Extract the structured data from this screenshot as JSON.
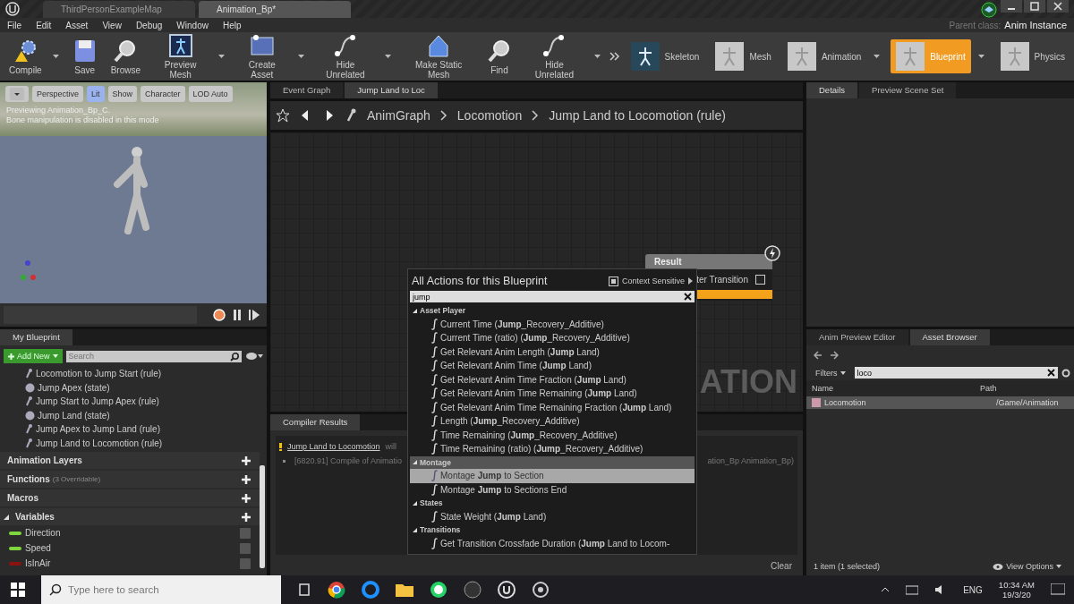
{
  "title_tabs": [
    {
      "label": "ThirdPersonExampleMap",
      "selected": false
    },
    {
      "label": "Animation_Bp*",
      "selected": true
    }
  ],
  "parent_class": {
    "label": "Parent class:",
    "value": "Anim Instance"
  },
  "menu": [
    "File",
    "Edit",
    "Asset",
    "View",
    "Debug",
    "Window",
    "Help"
  ],
  "toolbar": [
    {
      "label": "Compile",
      "kind": "compile",
      "dropdown": true
    },
    {
      "label": "Save",
      "kind": "save",
      "dropdown": false
    },
    {
      "label": "Browse",
      "kind": "browse",
      "dropdown": false
    },
    {
      "label": "Preview Mesh",
      "kind": "mesh",
      "dropdown": true
    },
    {
      "label": "Create Asset",
      "kind": "asset",
      "dropdown": true
    },
    {
      "label": "Hide Unrelated",
      "kind": "unrelated",
      "dropdown": true
    },
    {
      "label": "Make Static Mesh",
      "kind": "static",
      "dropdown": false
    },
    {
      "label": "Find",
      "kind": "find",
      "dropdown": false
    },
    {
      "label": "Hide Unrelated",
      "kind": "unrelated",
      "dropdown": true
    }
  ],
  "modes": [
    {
      "label": "Skeleton",
      "selected": false,
      "dropdown": false
    },
    {
      "label": "Mesh",
      "selected": false,
      "dropdown": false
    },
    {
      "label": "Animation",
      "selected": false,
      "dropdown": true
    },
    {
      "label": "Blueprint",
      "selected": true,
      "dropdown": true
    },
    {
      "label": "Physics",
      "selected": false,
      "dropdown": false
    }
  ],
  "viewport": {
    "buttons": [
      {
        "label": "Perspective",
        "selected": false
      },
      {
        "label": "Lit",
        "selected": true
      },
      {
        "label": "Show",
        "selected": false
      },
      {
        "label": "Character",
        "selected": false
      },
      {
        "label": "LOD Auto",
        "selected": false
      }
    ],
    "messages": [
      "Previewing Animation_Bp_C.",
      "Bone manipulation is disabled in this mode"
    ]
  },
  "my_blueprint": {
    "title": "My Blueprint",
    "add_button": "Add New",
    "search_placeholder": "Search",
    "tree": [
      {
        "label": "Locomotion to Jump Start (rule)",
        "kind": "rule"
      },
      {
        "label": "Jump Apex (state)",
        "kind": "state"
      },
      {
        "label": "Jump Start to Jump Apex (rule)",
        "kind": "rule"
      },
      {
        "label": "Jump Land (state)",
        "kind": "state"
      },
      {
        "label": "Jump Apex to Jump Land (rule)",
        "kind": "rule"
      },
      {
        "label": "Jump Land to Locomotion (rule)",
        "kind": "rule"
      }
    ],
    "sections": [
      {
        "label": "Animation Layers",
        "expanded": false
      },
      {
        "label": "Functions",
        "note": "(3 Overridable)",
        "expanded": false
      },
      {
        "label": "Macros",
        "expanded": false
      },
      {
        "label": "Variables",
        "expanded": true
      }
    ],
    "variables": [
      {
        "name": "Direction",
        "color": "#7ed63c"
      },
      {
        "name": "Speed",
        "color": "#7ed63c"
      },
      {
        "name": "IsInAir",
        "color": "#8c1212"
      }
    ]
  },
  "graph": {
    "tabs": [
      {
        "label": "Event Graph",
        "selected": false
      },
      {
        "label": "Jump Land to Loc",
        "selected": true
      }
    ],
    "breadcrumb": [
      "AnimGraph",
      "Locomotion",
      "Jump Land to Locomotion (rule)"
    ],
    "result_node": {
      "title": "Result",
      "pin": "ter Transition",
      "checked": false
    },
    "background_label": "ATION"
  },
  "action_menu": {
    "title": "All Actions for this Blueprint",
    "context_sensitive": {
      "label": "Context Sensitive",
      "checked": true
    },
    "search": "jump",
    "groups": [
      {
        "label": "Asset Player",
        "items": [
          {
            "text": "Current Time (**Jump**_Recovery_Additive)",
            "selected": false
          },
          {
            "text": "Current Time (ratio) (**Jump**_Recovery_Additive)",
            "selected": false
          },
          {
            "text": "Get Relevant Anim Length (**Jump** Land)",
            "selected": false
          },
          {
            "text": "Get Relevant Anim Time (**Jump** Land)",
            "selected": false
          },
          {
            "text": "Get Relevant Anim Time Fraction (**Jump** Land)",
            "selected": false
          },
          {
            "text": "Get Relevant Anim Time Remaining (**Jump** Land)",
            "selected": false
          },
          {
            "text": "Get Relevant Anim Time Remaining Fraction (**Jump** Land)",
            "selected": false
          },
          {
            "text": "Length (**Jump**_Recovery_Additive)",
            "selected": false
          },
          {
            "text": "Time Remaining (**Jump**_Recovery_Additive)",
            "selected": false
          },
          {
            "text": "Time Remaining (ratio) (**Jump**_Recovery_Additive)",
            "selected": false
          }
        ]
      },
      {
        "label": "Montage",
        "items": [
          {
            "text": "Montage **Jump** to Section",
            "selected": true
          },
          {
            "text": "Montage **Jump** to Sections End",
            "selected": false
          }
        ]
      },
      {
        "label": "States",
        "items": [
          {
            "text": "State Weight (**Jump** Land)",
            "selected": false
          }
        ]
      },
      {
        "label": "Transitions",
        "items": [
          {
            "text": "Get Transition Crossfade Duration (**Jump** Land to Locom-",
            "selected": false
          }
        ]
      }
    ]
  },
  "compiler": {
    "title": "Compiler Results",
    "lines": [
      {
        "kind": "warning",
        "link": "Jump Land to Locomotion",
        "text": "will"
      },
      {
        "kind": "info",
        "text": "[6820.91] Compile of Animatio",
        "tail": "ation_Bp Animation_Bp)"
      }
    ],
    "clear": "Clear"
  },
  "details": {
    "tabs": [
      {
        "label": "Details",
        "selected": true
      },
      {
        "label": "Preview Scene Set",
        "selected": false
      }
    ]
  },
  "asset_browser": {
    "tabs": [
      {
        "label": "Anim Preview Editor",
        "selected": false
      },
      {
        "label": "Asset Browser",
        "selected": true
      }
    ],
    "filters": "Filters",
    "search": "loco",
    "columns": [
      "Name",
      "Path"
    ],
    "rows": [
      {
        "name": "Locomotion",
        "path": "/Game/Animation",
        "selected": true
      }
    ],
    "status": "1 item (1 selected)",
    "view_options": "View Options"
  },
  "taskbar": {
    "search_placeholder": "Type here to search",
    "language": "ENG",
    "time": "10:34 AM",
    "date": "19/3/20"
  }
}
